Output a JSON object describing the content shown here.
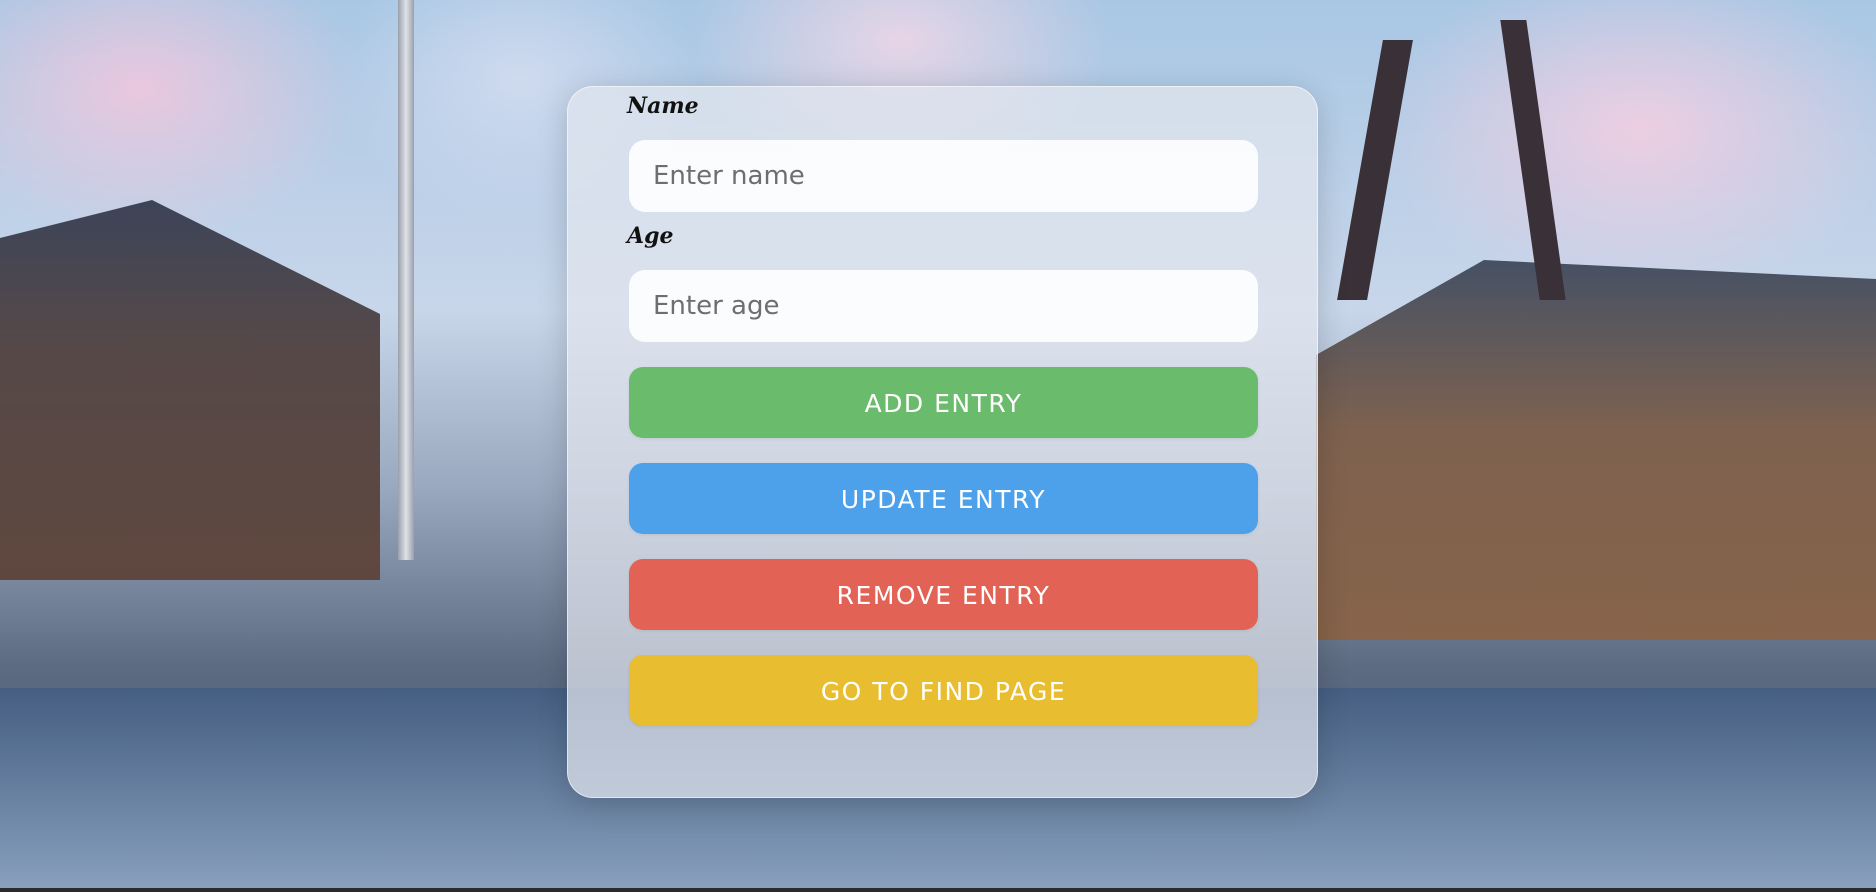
{
  "form": {
    "name_label": "Name",
    "name_placeholder": "Enter name",
    "name_value": "",
    "age_label": "Age",
    "age_placeholder": "Enter age",
    "age_value": ""
  },
  "buttons": {
    "add": "ADD ENTRY",
    "update": "UPDATE ENTRY",
    "remove": "REMOVE ENTRY",
    "find": "GO TO FIND PAGE"
  },
  "colors": {
    "add": "#6bbb6d",
    "update": "#4da1ea",
    "remove": "#e26356",
    "find": "#e8bd2f"
  }
}
